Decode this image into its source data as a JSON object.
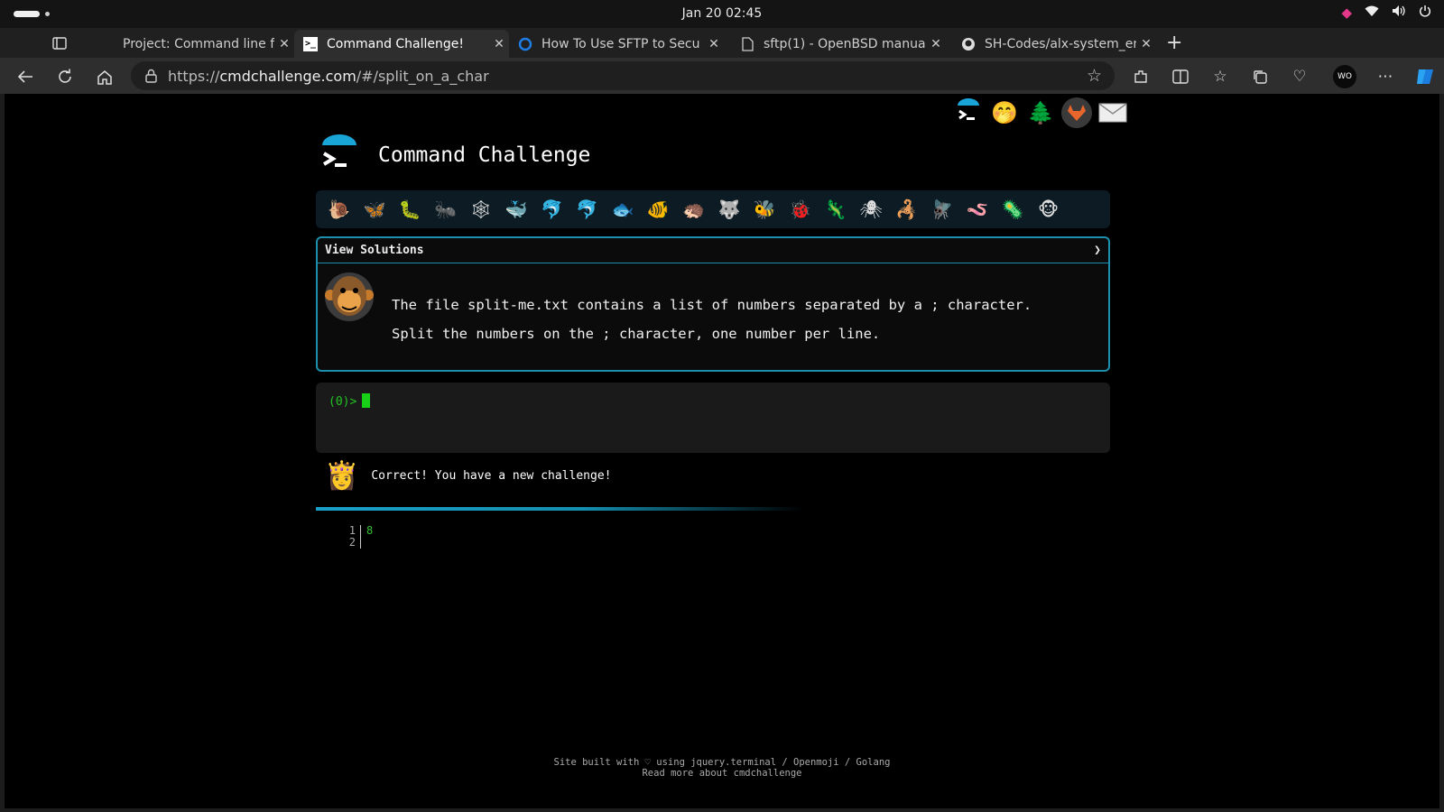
{
  "system": {
    "clock": "Jan 20  02:45"
  },
  "tabs": [
    {
      "title": "Project: Command line fo",
      "icon": "blank-page-icon"
    },
    {
      "title": "Command Challenge!",
      "icon": "terminal-icon",
      "active": true
    },
    {
      "title": "How To Use SFTP to Secu",
      "icon": "digitalocean-icon"
    },
    {
      "title": "sftp(1) - OpenBSD manua",
      "icon": "document-icon"
    },
    {
      "title": "SH-Codes/alx-system_eng",
      "icon": "github-icon"
    }
  ],
  "browser": {
    "url_scheme": "https://",
    "url_host": "cmdchallenge.com",
    "url_path": "/#/split_on_a_char",
    "profile_initials": "WO"
  },
  "site": {
    "title": "Command Challenge",
    "view_solutions": "View Solutions",
    "chevron": "❯",
    "challenge_line1": "The file split-me.txt contains a list of numbers separated by a ; character.",
    "challenge_line2": "Split the numbers on the ; character, one number per line.",
    "prompt": "(0)>",
    "notice": "Correct! You have a new challenge!",
    "output_lines": [
      {
        "num": "1",
        "text": "8"
      },
      {
        "num": "2",
        "text": ""
      }
    ],
    "footer_line1": "Site built with ♡ using jquery.terminal / Openmoji / Golang",
    "footer_line2": "Read more about cmdchallenge"
  },
  "critter_icons": [
    "🐌",
    "🦋",
    "🐛",
    "🐜",
    "🕸",
    "🐳",
    "🐬",
    "🐬",
    "🐟",
    "🐠",
    "🦔",
    "🐺",
    "🐝",
    "🐞",
    "🦎",
    "🕷",
    "🦂",
    "🪰",
    "🪱",
    "🦠",
    "🐵"
  ],
  "colors": {
    "accent": "#1d8fae",
    "prompt_green": "#22c322",
    "page_bg": "#000000"
  }
}
